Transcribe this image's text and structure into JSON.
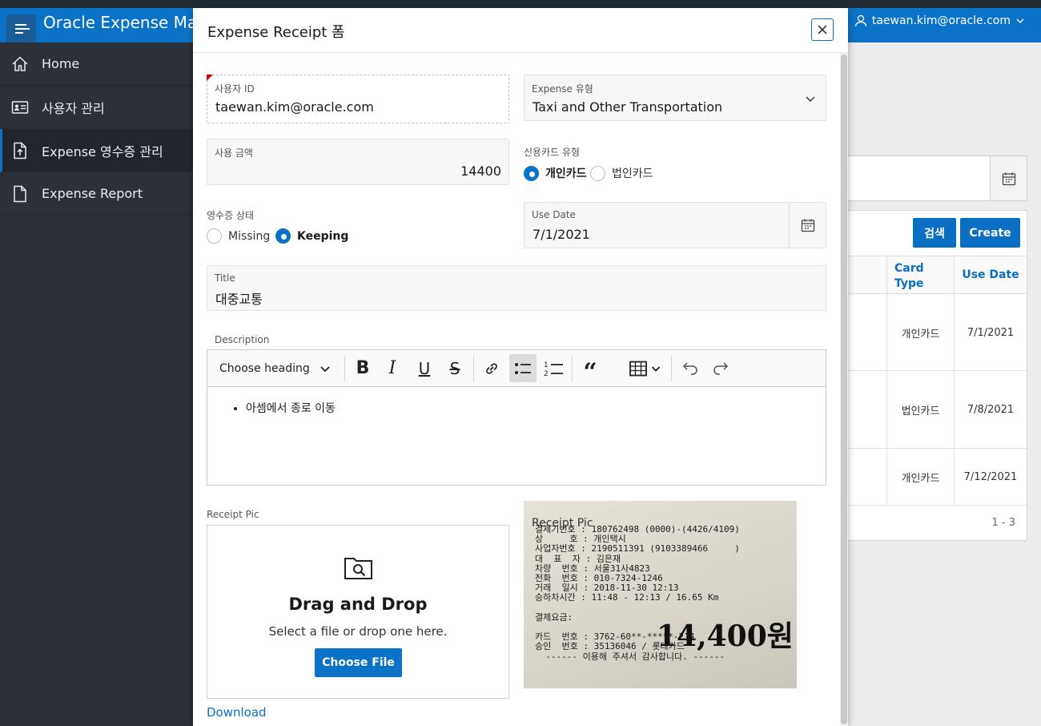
{
  "header": {
    "app_title": "Oracle Expense Man",
    "user": "taewan.kim@oracle.com"
  },
  "sidebar": {
    "items": [
      {
        "label": "Home",
        "icon": "home-icon"
      },
      {
        "label": "사용자 관리",
        "icon": "id-card-icon"
      },
      {
        "label": "Expense 영수증 관리",
        "icon": "file-upload-icon",
        "active": true
      },
      {
        "label": "Expense Report",
        "icon": "file-icon"
      }
    ]
  },
  "background": {
    "search_label": "검색",
    "create_label": "Create",
    "columns": [
      "Card Type",
      "Use Date"
    ],
    "rows": [
      {
        "card_type": "개인카드",
        "use_date": "7/1/2021"
      },
      {
        "card_type": "법인카드",
        "use_date": "7/8/2021"
      },
      {
        "card_type": "개인카드",
        "use_date": "7/12/2021"
      }
    ],
    "pagination": "1 - 3"
  },
  "modal": {
    "title": "Expense Receipt 폼",
    "user_id": {
      "label": "사용자 ID",
      "value": "taewan.kim@oracle.com"
    },
    "expense_type": {
      "label": "Expense 유형",
      "value": "Taxi and Other Transportation"
    },
    "amount": {
      "label": "사용 금액",
      "value": "14400"
    },
    "card_type": {
      "label": "신용카드 유형",
      "options": [
        "개인카드",
        "법인카드"
      ],
      "selected": "개인카드"
    },
    "receipt_status": {
      "label": "영수증 상태",
      "options": [
        "Missing",
        "Keeping"
      ],
      "selected": "Keeping"
    },
    "use_date": {
      "label": "Use Date",
      "value": "7/1/2021"
    },
    "title_field": {
      "label": "Title",
      "value": "대중교통"
    },
    "description": {
      "label": "Description",
      "heading_select": "Choose heading",
      "items": [
        "아셈에서 종로 이동"
      ]
    },
    "receipt_pic": {
      "label": "Receipt Pic",
      "drop_title": "Drag and Drop",
      "drop_sub": "Select a file or drop one here.",
      "choose_label": "Choose File",
      "download_label": "Download",
      "preview_label": "Receipt Pic",
      "receipt_lines": "결제기번호 : 180762498 (0000)-(4426/4109)\n상     호 : 개인택시\n사업자번호 : 2190511391 (9103389466     )\n대  표  자 : 김은재\n차량  번호 : 서울31사4823\n전화  번호 : 010-7324-1246\n거래  일시 : 2018-11-30 12:13\n승하차시간 : 11:48 - 12:13 / 16.65 Km\n\n결제요금:\n\n카드  번호 : 3762-60**-*****-214\n승인  번호 : 35136046 / 롯데카드\n  ------ 이용해 주셔서 감사합니다. ------",
      "receipt_amount": "14,400원"
    }
  }
}
